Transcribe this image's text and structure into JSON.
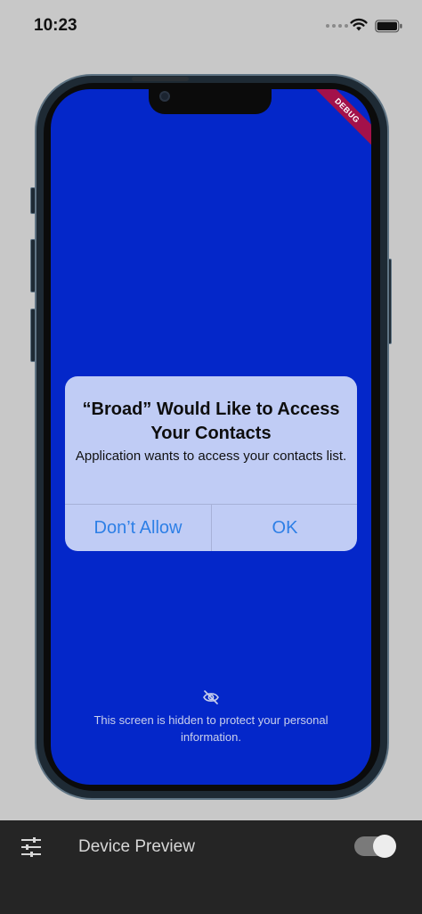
{
  "status_bar": {
    "time": "10:23",
    "signal_icon": "signal-dots-icon",
    "wifi_icon": "wifi-icon",
    "battery_icon": "battery-icon"
  },
  "screen": {
    "background": "#0427c9",
    "debug_banner": "DEBUG",
    "hidden_icon": "eye-slash-icon",
    "hidden_message": "This screen is hidden to protect your personal information."
  },
  "alert": {
    "title": "“Broad” Would Like to Access Your Contacts",
    "message": "Application wants to access your contacts list.",
    "deny_label": "Don’t Allow",
    "allow_label": "OK",
    "button_color": "#2d7fe6"
  },
  "toolbar": {
    "settings_icon": "sliders-icon",
    "title": "Device Preview",
    "toggle_on": true
  }
}
